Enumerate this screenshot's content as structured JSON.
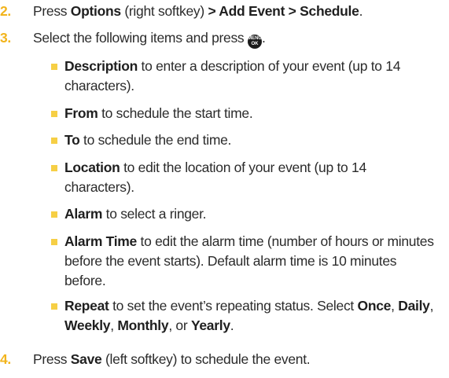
{
  "step2": {
    "num": "2.",
    "press": "Press ",
    "options": "Options",
    "softkey": " (right softkey) ",
    "path": "> Add Event > Schedule",
    "end": "."
  },
  "step3": {
    "num": "3.",
    "text": "Select the following items and press",
    "icon_top": "MENU",
    "icon_bottom": "OK",
    "end": "."
  },
  "items": [
    {
      "term": "Description",
      "text": " to enter a description of your event (up to 14 characters)."
    },
    {
      "term": "From",
      "text": " to schedule the start time."
    },
    {
      "term": "To",
      "text": " to schedule the end time."
    },
    {
      "term": "Location",
      "text": " to edit the location of your event (up to 14 characters)."
    },
    {
      "term": "Alarm",
      "text": " to select a ringer."
    },
    {
      "term": "Alarm Time",
      "text": " to edit the alarm time (number of hours or minutes before the event starts). Default alarm time is 10 minutes before."
    },
    {
      "term": "Repeat",
      "text": " to set the event’s repeating status. Select "
    }
  ],
  "repeat_options": {
    "once": "Once",
    "sep1": ", ",
    "daily": "Daily",
    "sep2": ", ",
    "weekly": "Weekly",
    "sep3": ", ",
    "monthly": "Monthly",
    "sep4": ", or ",
    "yearly": "Yearly",
    "end": "."
  },
  "step4": {
    "num": "4.",
    "press": "Press ",
    "save": "Save",
    "rest": " (left softkey) to schedule the event."
  }
}
